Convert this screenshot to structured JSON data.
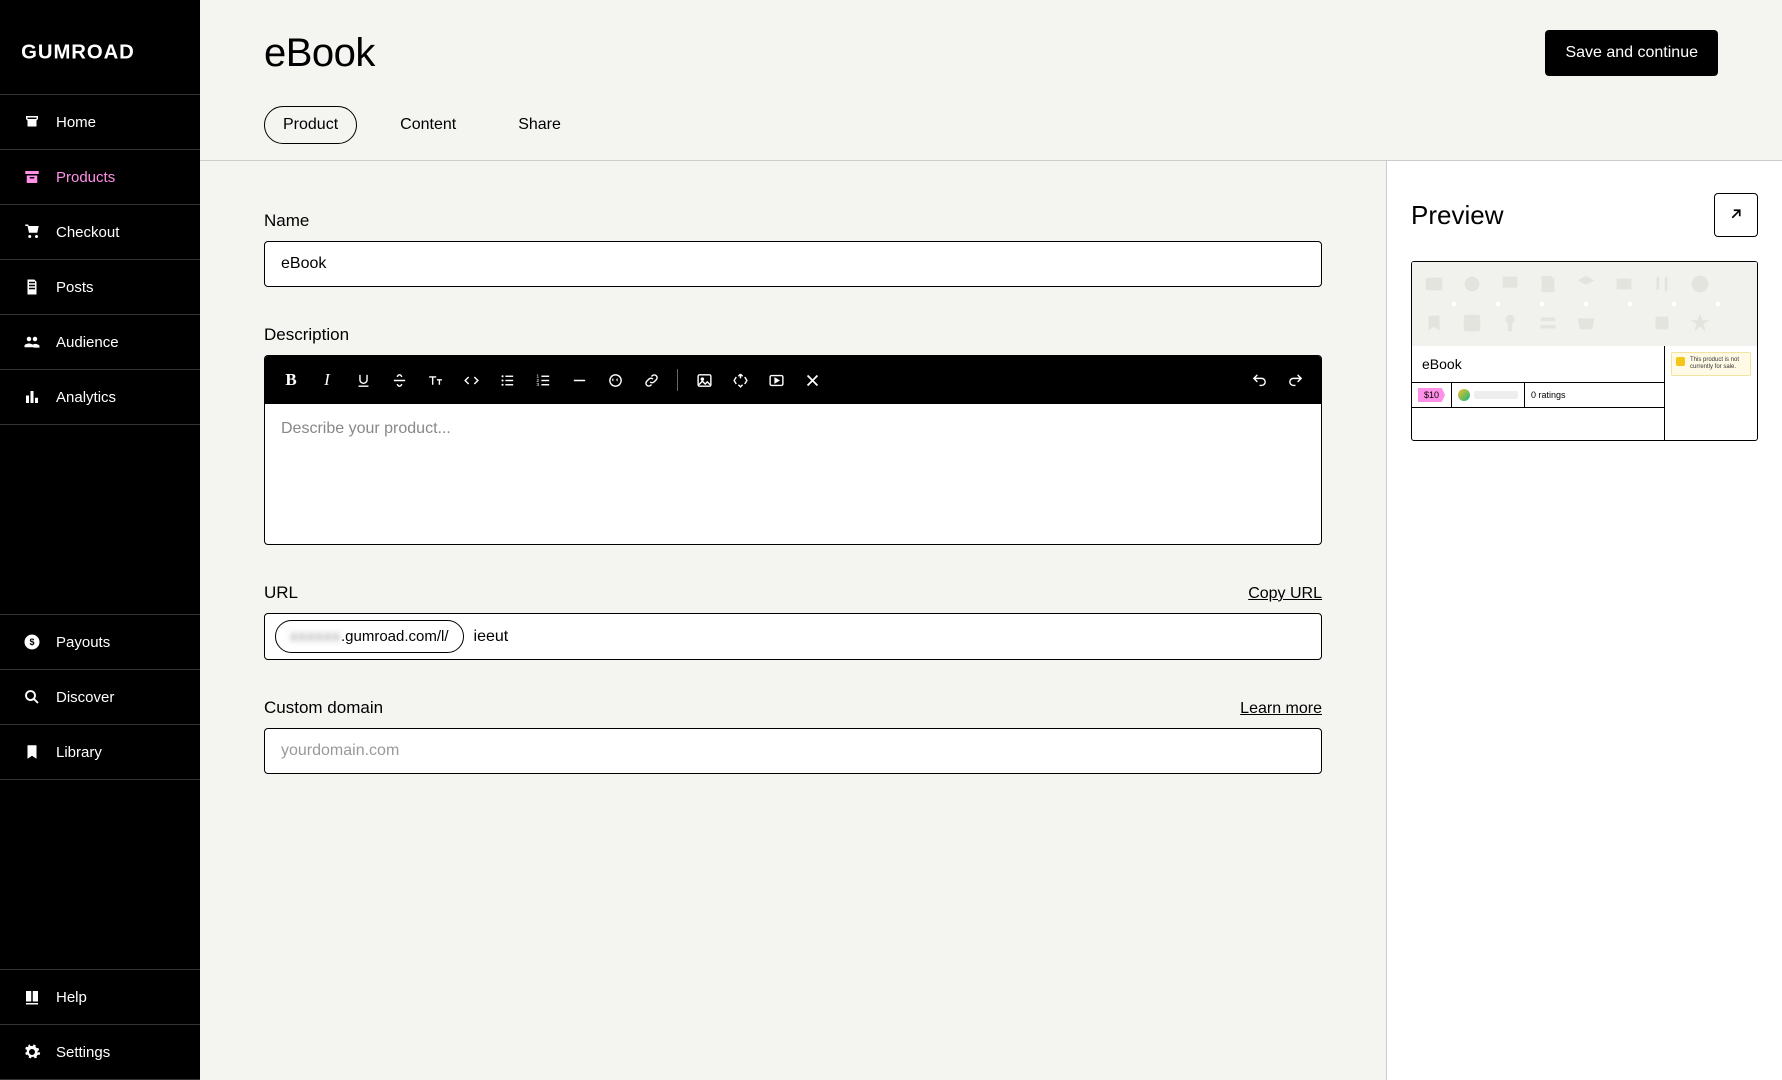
{
  "brand": "GUMROAD",
  "sidebar": {
    "items": [
      {
        "label": "Home"
      },
      {
        "label": "Products"
      },
      {
        "label": "Checkout"
      },
      {
        "label": "Posts"
      },
      {
        "label": "Audience"
      },
      {
        "label": "Analytics"
      },
      {
        "label": "Payouts"
      },
      {
        "label": "Discover"
      },
      {
        "label": "Library"
      },
      {
        "label": "Help"
      },
      {
        "label": "Settings"
      }
    ]
  },
  "header": {
    "title": "eBook",
    "save_label": "Save and continue",
    "tabs": [
      {
        "label": "Product"
      },
      {
        "label": "Content"
      },
      {
        "label": "Share"
      }
    ]
  },
  "form": {
    "name": {
      "label": "Name",
      "value": "eBook"
    },
    "description": {
      "label": "Description",
      "placeholder": "Describe your product..."
    },
    "url": {
      "label": "URL",
      "copy_label": "Copy URL",
      "prefix_hidden": "xxxxxx",
      "prefix_visible": ".gumroad.com/l/",
      "value": "ieeut"
    },
    "custom_domain": {
      "label": "Custom domain",
      "learn_more": "Learn more",
      "placeholder": "yourdomain.com"
    }
  },
  "preview": {
    "heading": "Preview",
    "product_name": "eBook",
    "price": "$10",
    "ratings": "0 ratings",
    "notice": "This product is not currently for sale."
  }
}
